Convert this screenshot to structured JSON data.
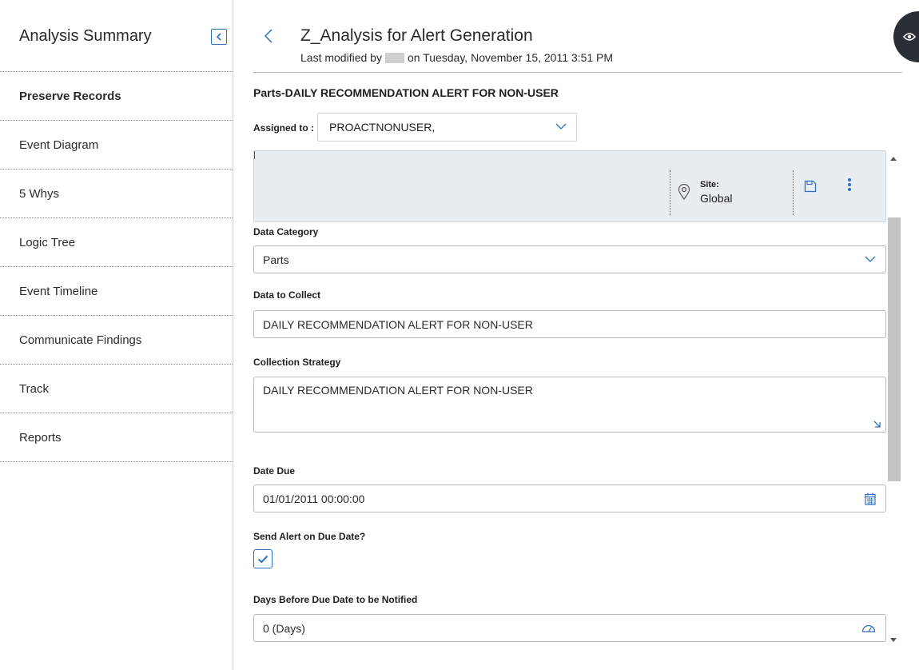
{
  "sidebar": {
    "title": "Analysis Summary",
    "items": [
      {
        "label": "Preserve Records",
        "active": true
      },
      {
        "label": "Event Diagram"
      },
      {
        "label": "5 Whys"
      },
      {
        "label": "Logic Tree"
      },
      {
        "label": "Event Timeline"
      },
      {
        "label": "Communicate Findings"
      },
      {
        "label": "Track"
      },
      {
        "label": "Reports"
      }
    ]
  },
  "header": {
    "title": "Z_Analysis for Alert Generation",
    "modified_prefix": "Last modified by",
    "modified_suffix": "on Tuesday, November 15, 2011 3:51 PM"
  },
  "record": {
    "title": "Parts-DAILY RECOMMENDATION ALERT FOR NON-USER",
    "assigned_label": "Assigned to :",
    "assigned_value": "PROACTNONUSER,"
  },
  "toolbar": {
    "site_label": "Site:",
    "site_value": "Global"
  },
  "form": {
    "data_category": {
      "label": "Data Category",
      "value": "Parts"
    },
    "data_to_collect": {
      "label": "Data to Collect",
      "value": "DAILY RECOMMENDATION ALERT FOR NON-USER"
    },
    "collection_strategy": {
      "label": "Collection Strategy",
      "value": "DAILY RECOMMENDATION ALERT FOR NON-USER"
    },
    "date_due": {
      "label": "Date Due",
      "value": "01/01/2011 00:00:00"
    },
    "send_alert": {
      "label": "Send Alert on Due Date?",
      "checked": true
    },
    "days_before": {
      "label": "Days Before Due Date to be Notified",
      "value": "0 (Days)"
    }
  },
  "colors": {
    "accent": "#2f6fbf",
    "fab": "#2a2e37",
    "toolbar_bg": "#e8edf2"
  }
}
